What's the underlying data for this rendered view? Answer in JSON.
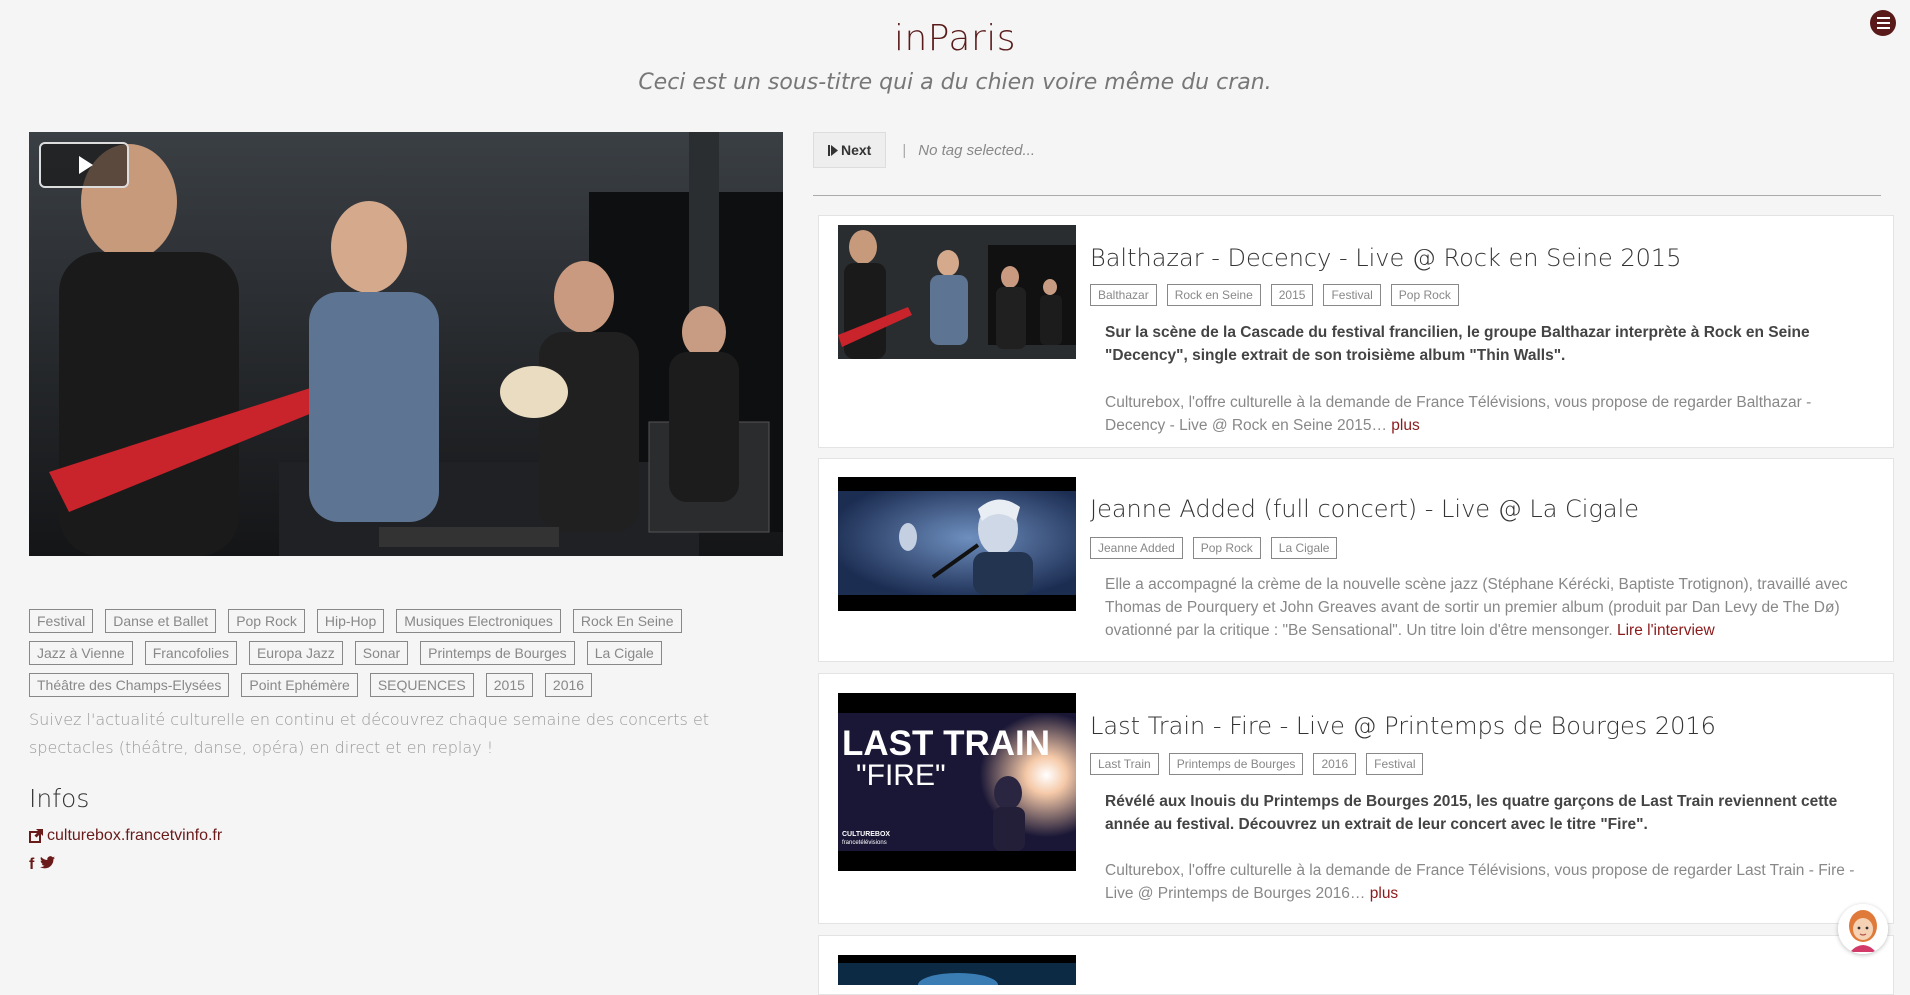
{
  "header": {
    "title": "inParis",
    "subtitle": "Ceci est un sous-titre qui a du chien voire même du cran."
  },
  "player": {
    "play_icon": "play-icon"
  },
  "sidebar": {
    "tags": [
      "Festival",
      "Danse et Ballet",
      "Pop Rock",
      "Hip-Hop",
      "Musiques Electroniques",
      "Rock En Seine",
      "Jazz à Vienne",
      "Francofolies",
      "Europa Jazz",
      "Sonar",
      "Printemps de Bourges",
      "La Cigale",
      "Théâtre des Champs-Elysées",
      "Point Ephémère",
      "SEQUENCES",
      "2015",
      "2016"
    ],
    "description": "Suivez l'actualité culturelle en continu et découvrez chaque semaine des concerts et spectacles (théâtre, danse, opéra) en direct et en replay !",
    "infos_heading": "Infos",
    "link_text": "culturebox.francetvinfo.fr",
    "social": [
      "f",
      "t"
    ]
  },
  "toolbar": {
    "next_label": "Next",
    "separator": "|",
    "status": "No tag selected..."
  },
  "videos": [
    {
      "title": "Balthazar - Decency - Live @ Rock en Seine 2015",
      "tags": [
        "Balthazar",
        "Rock en Seine",
        "2015",
        "Festival",
        "Pop Rock"
      ],
      "lead": "Sur la scène de la Cascade du festival francilien, le groupe Balthazar interprète à Rock en Seine \"Decency\", single extrait de son troisième album \"Thin Walls\".",
      "body": "Culturebox, l'offre culturelle à la demande de France Télévisions, vous propose de regarder Balthazar - Decency - Live @ Rock en Seine 2015…",
      "more": "plus"
    },
    {
      "title": "Jeanne Added (full concert) - Live @ La Cigale",
      "tags": [
        "Jeanne Added",
        "Pop Rock",
        "La Cigale"
      ],
      "body": "Elle a accompagné la crème de la nouvelle scène jazz (Stéphane Kérécki, Baptiste Trotignon), travaillé avec Thomas de Pourquery et John Greaves avant de sortir un premier album (produit par Dan Levy de The Dø) ovationné par la critique : \"Be Sensational\". Un titre loin d'être mensonger.",
      "more": "Lire l'interview"
    },
    {
      "title": "Last Train - Fire - Live @ Printemps de Bourges 2016",
      "tags": [
        "Last Train",
        "Printemps de Bourges",
        "2016",
        "Festival"
      ],
      "thumb_line1": "LAST TRAIN",
      "thumb_line2": "\"FIRE\"",
      "thumb_brand1": "CULTUREBOX",
      "thumb_brand2": "francetélévisions",
      "lead": "Révélé aux Inouis du Printemps de Bourges 2015, les quatre garçons de Last Train reviennent cette année au festival. Découvrez un extrait de leur concert avec le titre \"Fire\".",
      "body": "Culturebox, l'offre culturelle à la demande de France Télévisions, vous propose de regarder Last Train - Fire - Live @ Printemps de Bourges 2016…",
      "more": "plus"
    }
  ],
  "colors": {
    "accent": "#5a1a1a",
    "link": "#8b1a1a",
    "background": "#f5f5f5"
  }
}
